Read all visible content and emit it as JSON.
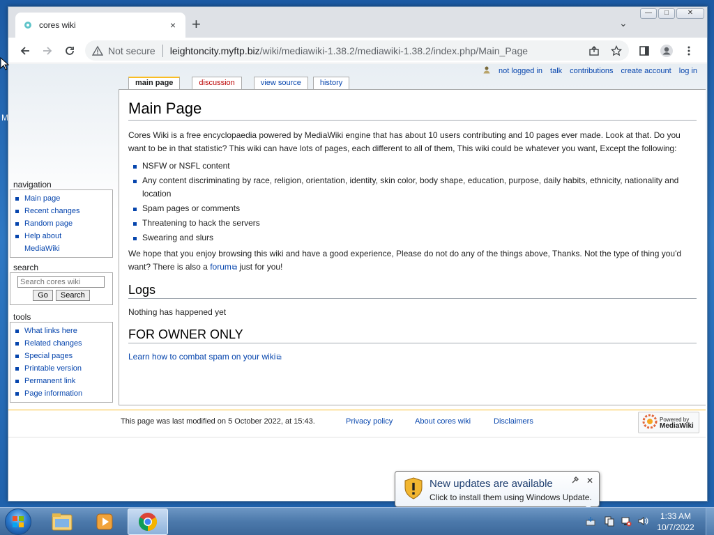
{
  "browser": {
    "tab_title": "cores wiki",
    "tab_close": "×",
    "new_tab": "+",
    "tab_search": "⌄",
    "security_label": "Not secure",
    "url_host": "leightoncity.myftp.biz",
    "url_path": "/wiki/mediawiki-1.38.2/mediawiki-1.38.2/index.php/Main_Page",
    "window_controls": {
      "minimize": "—",
      "maximize": "□",
      "close": "✕"
    }
  },
  "desktop": {
    "edge_letter": "M"
  },
  "personal_tools": {
    "user": "not logged in",
    "talk": "talk",
    "contributions": "contributions",
    "create_account": "create account",
    "login": "log in"
  },
  "page_tabs": {
    "main_page": "main page",
    "discussion": "discussion",
    "view_source": "view source",
    "history": "history"
  },
  "sidebar": {
    "navigation": {
      "heading": "navigation",
      "items": [
        "Main page",
        "Recent changes",
        "Random page",
        "Help about",
        "MediaWiki"
      ]
    },
    "search": {
      "heading": "search",
      "placeholder": "Search cores wiki",
      "go": "Go",
      "search_button": "Search"
    },
    "tools": {
      "heading": "tools",
      "items": [
        "What links here",
        "Related changes",
        "Special pages",
        "Printable version",
        "Permanent link",
        "Page information"
      ]
    }
  },
  "content": {
    "title": "Main Page",
    "intro": "Cores Wiki is a free encyclopaedia powered by MediaWiki engine that has about 10 users contributing and 10 pages ever made. Look at that. Do you want to be in that statistic? This wiki can have lots of pages, each different to all of them, This wiki could be whatever you want, Except the following:",
    "rules": [
      "NSFW or NSFL content",
      "Any content discriminating by race, religion, orientation, identity, skin color, body shape, education, purpose, daily habits, ethnicity, nationality and location",
      "Spam pages or comments",
      "Threatening to hack the servers",
      "Swearing and slurs"
    ],
    "closing_before": "We hope that you enjoy browsing this wiki and have a good experience, Please do not do any of the things above, Thanks. Not the type of thing you'd want? There is also a ",
    "forum_link": "forum",
    "closing_after": " just for you!",
    "logs_heading": "Logs",
    "logs_text": "Nothing has happened yet",
    "owner_heading": "FOR OWNER ONLY",
    "spam_link": "Learn how to combat spam on your wiki"
  },
  "footer": {
    "last_modified": "This page was last modified on 5 October 2022, at 15:43.",
    "privacy": "Privacy policy",
    "about": "About cores wiki",
    "disclaimers": "Disclaimers",
    "powered_top": "Powered by",
    "powered_bottom": "MediaWiki"
  },
  "notification": {
    "title": "New updates are available",
    "text": "Click to install them using Windows Update.",
    "close": "✕"
  },
  "taskbar": {
    "time": "1:33 AM",
    "date": "10/7/2022"
  },
  "colors": {
    "link": "#0645ad",
    "redlink": "#ba0000",
    "selected_tab_accent": "#fabd23"
  }
}
